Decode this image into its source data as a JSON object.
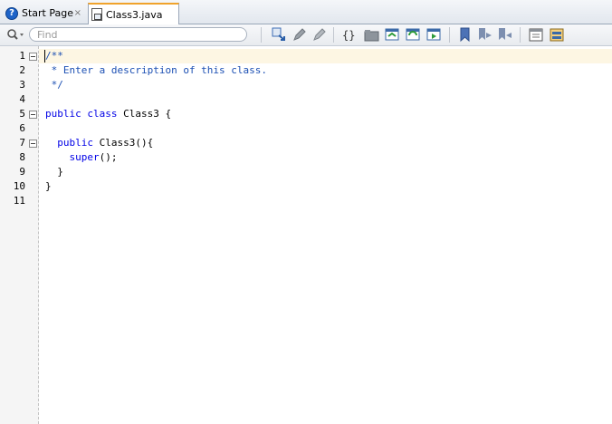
{
  "tabs": [
    {
      "label": "Start Page",
      "icon": "help-icon",
      "active": false
    },
    {
      "label": "Class3.java",
      "icon": "java-file-icon",
      "active": true
    }
  ],
  "close_glyph": "×",
  "toolbar": {
    "find_placeholder": "Find"
  },
  "editor": {
    "line_numbers": [
      "1",
      "2",
      "3",
      "4",
      "5",
      "6",
      "7",
      "8",
      "9",
      "10",
      "11"
    ],
    "lines": [
      [
        {
          "t": "/**",
          "c": "cm"
        }
      ],
      [
        {
          "t": " * Enter a description of this class.",
          "c": "cm"
        }
      ],
      [
        {
          "t": " */",
          "c": "cm"
        }
      ],
      [],
      [
        {
          "t": "public class ",
          "c": "kw"
        },
        {
          "t": "Class3 {",
          "c": ""
        }
      ],
      [],
      [
        {
          "t": "  public ",
          "c": "kw"
        },
        {
          "t": "Class3(){",
          "c": ""
        }
      ],
      [
        {
          "t": "    super",
          "c": "kw"
        },
        {
          "t": "();",
          "c": ""
        }
      ],
      [
        {
          "t": "  }",
          "c": ""
        }
      ],
      [
        {
          "t": "}",
          "c": ""
        }
      ],
      []
    ],
    "fold_lines": [
      1,
      5,
      7
    ]
  }
}
